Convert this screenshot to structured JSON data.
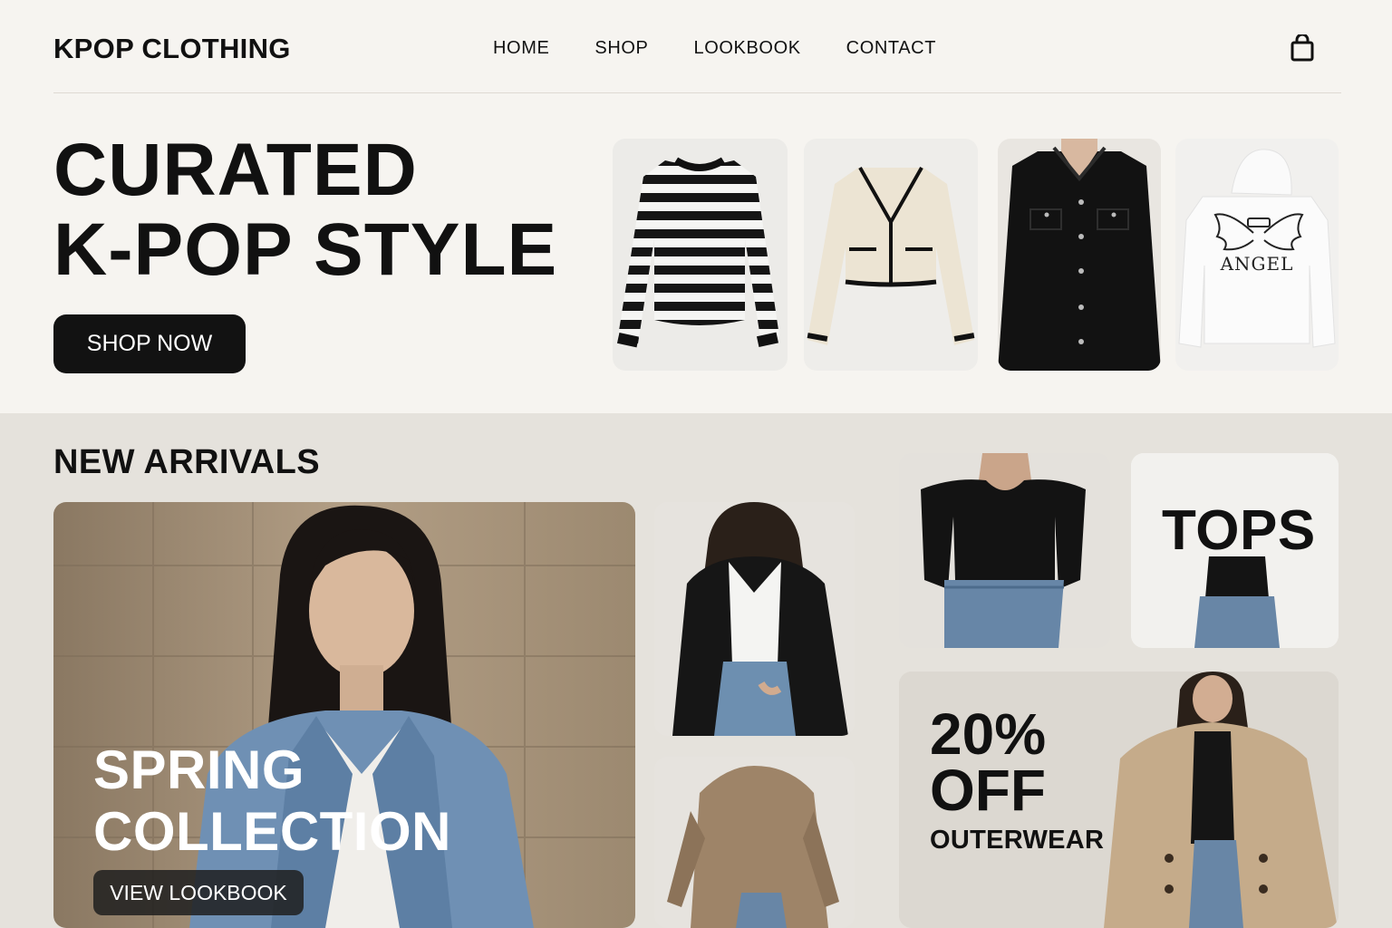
{
  "header": {
    "brand": "KPOP CLOTHING",
    "nav": [
      "HOME",
      "SHOP",
      "LOOKBOOK",
      "CONTACT"
    ],
    "cart_icon": "shopping-bag-icon"
  },
  "hero": {
    "title_line1": "CURATED",
    "title_line2": "K-POP STYLE",
    "cta": "SHOP NOW",
    "products": [
      {
        "name": "striped-sweater"
      },
      {
        "name": "cream-cardigan"
      },
      {
        "name": "black-shirt-jacket"
      },
      {
        "name": "white-hoodie",
        "print_text": "ANGEL"
      }
    ]
  },
  "arrivals": {
    "title": "NEW ARRIVALS",
    "feature": {
      "title_line1": "SPRING",
      "title_line2": "COLLECTION",
      "cta": "VIEW LOOKBOOK"
    },
    "category": {
      "label": "TOPS"
    },
    "promo": {
      "line1": "20%",
      "line2": "OFF",
      "line3": "OUTERWEAR"
    }
  },
  "colors": {
    "background": "#f6f4f0",
    "section_background": "#e5e2dc",
    "button": "#121212",
    "text": "#111111"
  }
}
